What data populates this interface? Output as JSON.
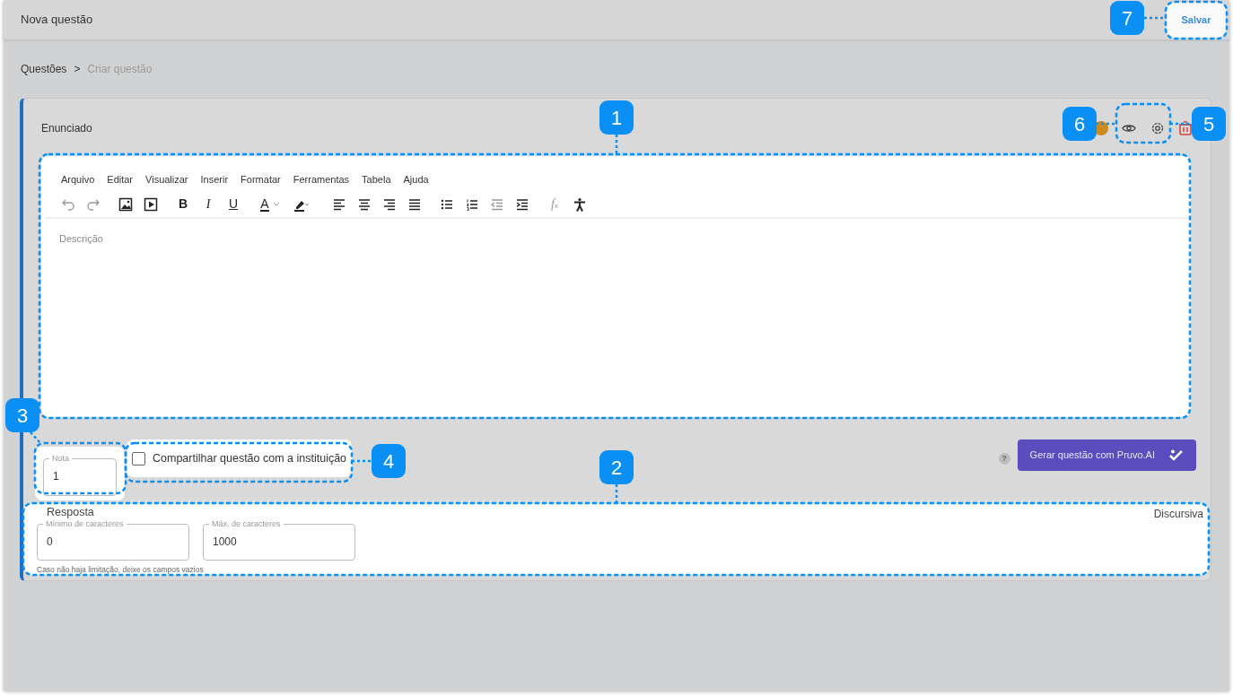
{
  "header": {
    "title": "Nova questão",
    "save_button": "Salvar"
  },
  "breadcrumb": [
    {
      "label": "Questões",
      "current": false
    },
    {
      "label": ">",
      "current": false
    },
    {
      "label": "Criar questão",
      "current": true
    }
  ],
  "statement": {
    "label": "Enunciado",
    "editor": {
      "menu": [
        "Arquivo",
        "Editar",
        "Visualizar",
        "Inserir",
        "Formatar",
        "Ferramentas",
        "Tabela",
        "Ajuda"
      ],
      "toolbar": [
        [
          {
            "kind": "undo",
            "disabled": true
          },
          {
            "kind": "redo",
            "disabled": true
          }
        ],
        [
          {
            "kind": "image",
            "disabled": false
          },
          {
            "kind": "media",
            "disabled": false
          }
        ],
        [
          {
            "kind": "bold",
            "text": "B",
            "disabled": false
          },
          {
            "kind": "italic",
            "text": "I",
            "disabled": false
          },
          {
            "kind": "underline",
            "text": "U",
            "disabled": false
          }
        ],
        [
          {
            "kind": "text-color",
            "text": "A",
            "disabled": false
          },
          {
            "kind": "highlight",
            "disabled": false
          }
        ],
        [
          {
            "kind": "align-left",
            "disabled": false
          },
          {
            "kind": "align-center",
            "disabled": false
          },
          {
            "kind": "align-right",
            "disabled": false
          },
          {
            "kind": "justify",
            "disabled": false
          }
        ],
        [
          {
            "kind": "bullet-list",
            "disabled": false
          },
          {
            "kind": "numbered-list",
            "disabled": false
          },
          {
            "kind": "outdent",
            "disabled": true
          },
          {
            "kind": "indent",
            "disabled": false
          }
        ],
        [
          {
            "kind": "formula",
            "text": "f",
            "sub": "x",
            "disabled": true
          },
          {
            "kind": "accessibility",
            "disabled": false
          }
        ]
      ],
      "placeholder": "Descrição"
    }
  },
  "grade": {
    "label": "Nota",
    "value": "1"
  },
  "share": {
    "label": "Compartilhar questão com a instituição",
    "checked": false
  },
  "help": "?",
  "ai_button": "Gerar questão com Pruvo.AI",
  "answer": {
    "title": "Resposta",
    "type": "Discursiva",
    "fields": [
      {
        "label": "Mínimo de caracteres",
        "value": "0"
      },
      {
        "label": "Máx. de caracteres",
        "value": "1000"
      }
    ],
    "hint": "Caso não haja limitação, deixe os campos vazios"
  },
  "callouts": [
    "7",
    "1",
    "6",
    "5",
    "3",
    "4",
    "2"
  ]
}
